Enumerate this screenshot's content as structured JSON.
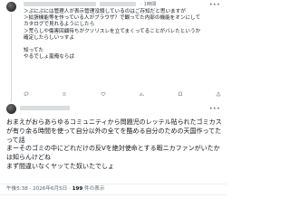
{
  "reply": {
    "time": "1時間",
    "more_icon": "more-horizontal-icon",
    "text": "＞ぷにぷには管理人が表示管理没頭しているのはご存知だと思いますが\n＞拡張機能等を作っている人がブラウザ？で観ってた内部の機能をオンにして\nカタログで見れるようにしたら\n＞荒らしや傷害回顧待ちがクソリスレを立てまくってることがバレたというか\n確定したらしいっすよ\n\n知ってた\nやるでしょ嵐俺ならば",
    "actions": [
      "reply-icon",
      "repost-icon",
      "like-icon",
      "views-icon",
      "bookmark-icon",
      "share-icon"
    ]
  },
  "main": {
    "more_icon": "more-horizontal-icon",
    "text": "おまえがおらあらゆるコミュニティから問題児のレッテル貼られたゴミカスが有り余る時間を使って自分以外の全てを酷める自分のための天国作ってたって話\nまーそのゴミの中にどれだけの反Vを絶対使命とする暇ニカファンがいたかは知らんけどね\nまず間違いなくヤッてた奴いたでしょ",
    "time": "午後5:38 · 2026年6月5日",
    "views_count": "199",
    "views_label": "件の表示"
  }
}
